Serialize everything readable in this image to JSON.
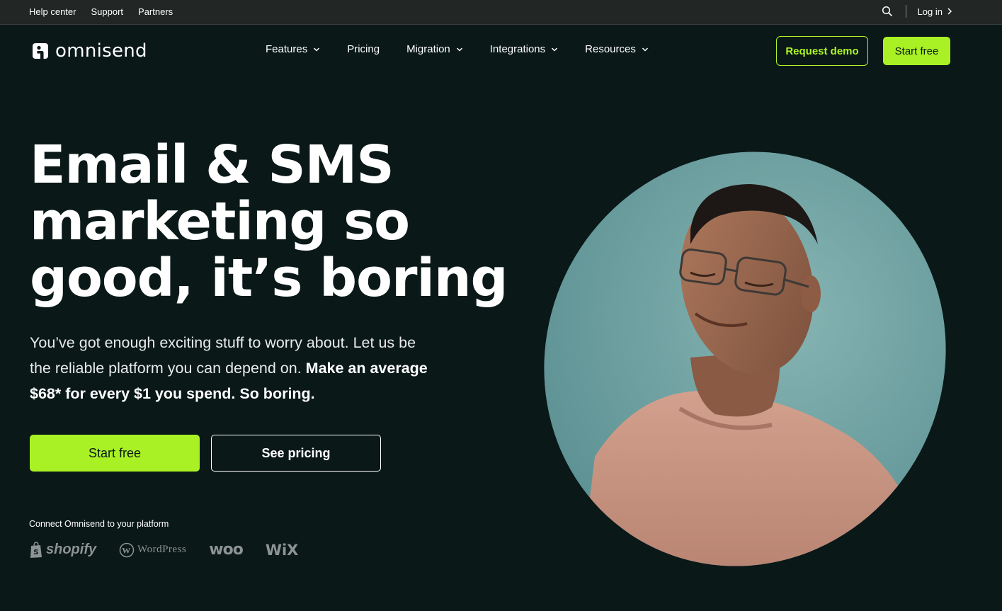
{
  "utility": {
    "links": [
      "Help center",
      "Support",
      "Partners"
    ],
    "login_label": "Log in"
  },
  "nav": {
    "brand": "omnisend",
    "items": [
      {
        "label": "Features",
        "has_dropdown": true
      },
      {
        "label": "Pricing",
        "has_dropdown": false
      },
      {
        "label": "Migration",
        "has_dropdown": true
      },
      {
        "label": "Integrations",
        "has_dropdown": true
      },
      {
        "label": "Resources",
        "has_dropdown": true
      }
    ],
    "request_demo_label": "Request demo",
    "start_free_label": "Start free"
  },
  "hero": {
    "title_lines": [
      "Email & SMS",
      "marketing so",
      "good, it’s boring"
    ],
    "subtitle_plain": "You’ve got enough exciting stuff to worry about. Let us be the reliable platform you can depend on. ",
    "subtitle_strong": "Make an average $68* for every $1 you spend. So boring.",
    "start_free_label": "Start free",
    "see_pricing_label": "See pricing",
    "connect_label": "Connect Omnisend to your platform",
    "platforms": [
      "shopify",
      "WordPress",
      "woo",
      "WiX"
    ]
  },
  "colors": {
    "background": "#0a1818",
    "accent": "#a9f125",
    "utility_bar": "#222625",
    "image_bg": "#6e9ea0"
  }
}
